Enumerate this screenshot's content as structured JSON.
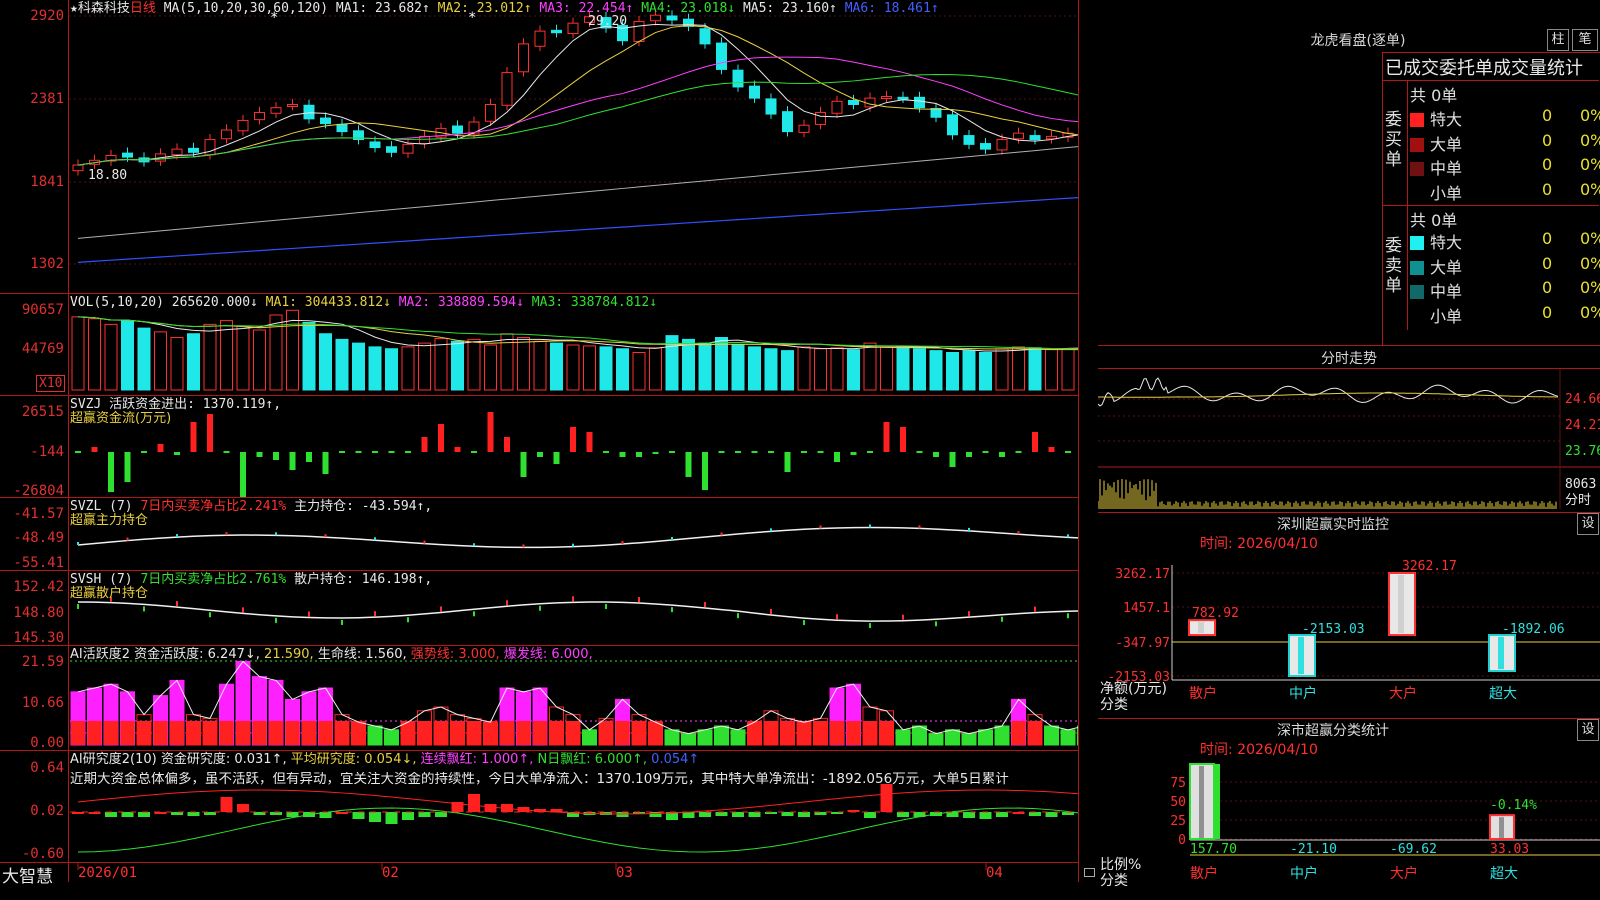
{
  "main": {
    "title_star": "★",
    "stock_name": "科森科技",
    "period": "日线",
    "ma_label": "MA(5,10,20,30,60,120)",
    "ma_values": [
      {
        "name": "MA1:",
        "value": "23.682↑",
        "color": "#e8e8e8"
      },
      {
        "name": "MA2:",
        "value": "23.012↑",
        "color": "#e8d040"
      },
      {
        "name": "MA3:",
        "value": "22.454↑",
        "color": "#ff40ff"
      },
      {
        "name": "MA4:",
        "value": "23.018↓",
        "color": "#30e030"
      },
      {
        "name": "MA5:",
        "value": "23.160↑",
        "color": "#c8c8c8"
      },
      {
        "name": "MA6:",
        "value": "18.461↑",
        "color": "#4060ff"
      }
    ],
    "y_labels": [
      "2920",
      "2381",
      "1841",
      "1302"
    ],
    "high_label": "29.20",
    "low_label": "18.80"
  },
  "vol": {
    "label": "VOL(5,10,20)",
    "value": "265620.000↓",
    "ma1": "MA1: 304433.812↓",
    "ma2": "MA2: 338889.594↓",
    "ma3": "MA3: 338784.812↓",
    "y_labels": [
      "90657",
      "44769"
    ],
    "unit": "X10"
  },
  "svzj": {
    "label": "SVZJ",
    "text": "活跃资金进出: 1370.119↑,",
    "sub": "超赢资金流(万元)",
    "y_labels": [
      "26515",
      "-144",
      "-26804"
    ]
  },
  "svzl": {
    "label": "SVZL (7)",
    "pct": "7日内买卖净占比2.241%",
    "text": "主力持仓: -43.594↑,",
    "sub": "超赢主力持仓",
    "y_labels": [
      "-41.57",
      "-48.49",
      "-55.41"
    ]
  },
  "svsh": {
    "label": "SVSH (7)",
    "pct": "7日内买卖净占比2.761%",
    "text": "散户持仓: 146.198↑,",
    "sub": "超赢散户持仓",
    "y_labels": [
      "152.42",
      "148.80",
      "145.30"
    ]
  },
  "ai1": {
    "label": "AI活跃度2",
    "t1": "资金活跃度: 6.247↓,",
    "t2": "21.590,",
    "t3": "生命线: 1.560,",
    "t4": "强势线: 3.000,",
    "t5": "爆发线: 6.000,",
    "y_labels": [
      "21.59",
      "10.66",
      "0.00"
    ]
  },
  "ai2": {
    "label": "AI研究度2(10)",
    "t1": "资金研究度: 0.031↑,",
    "t2": "平均研究度: 0.054↓,",
    "t3": "连续飘红: 1.000↑,",
    "t4": "N日飘红: 6.000↑,",
    "t5": "0.054↑",
    "comment": "近期大资金总体偏多，虽不活跃，但有异动，宜关注大资金的持续性，今日大单净流入：1370.109万元，其中特大单净流出：-1892.056万元，大单5日累计",
    "y_labels": [
      "0.64",
      "0.02",
      "-0.60"
    ]
  },
  "xaxis": {
    "brand": "大智慧",
    "labels": [
      "2026/01",
      "02",
      "03",
      "04"
    ]
  },
  "right": {
    "longhu_title": "龙虎看盘(逐单)",
    "btn1": "柱",
    "btn2": "笔",
    "tabs": "已成交委托单成交量统计",
    "buy": {
      "side": "委买单",
      "total": "共 0单",
      "rows": [
        {
          "label": "特大",
          "qty": "0",
          "pct": "0%",
          "color": "#ff2020"
        },
        {
          "label": "大单",
          "qty": "0",
          "pct": "0%",
          "color": "#a01010"
        },
        {
          "label": "中单",
          "qty": "0",
          "pct": "0%",
          "color": "#701010"
        },
        {
          "label": "小单",
          "qty": "0",
          "pct": "0%",
          "color": "#000000"
        }
      ]
    },
    "sell": {
      "side": "委卖单",
      "total": "共 0单",
      "rows": [
        {
          "label": "特大",
          "qty": "0",
          "pct": "0%",
          "color": "#20f0f0"
        },
        {
          "label": "大单",
          "qty": "0",
          "pct": "0%",
          "color": "#109090"
        },
        {
          "label": "中单",
          "qty": "0",
          "pct": "0%",
          "color": "#106868"
        },
        {
          "label": "小单",
          "qty": "0",
          "pct": "0%",
          "color": "#000000"
        }
      ]
    },
    "intraday": {
      "title": "分时走势",
      "y_labels": [
        "24.66",
        "24.21",
        "23.76"
      ],
      "vol_label": "8063",
      "vol_unit": "分时"
    },
    "sz_monitor": {
      "title": "深圳超赢实时监控",
      "set": "设",
      "time": "时间: 2026/04/10",
      "y_labels": [
        "3262.17",
        "1457.1",
        "-347.97",
        "-2153.03"
      ],
      "cats": [
        "散户",
        "中户",
        "大户",
        "超大"
      ],
      "values": [
        782.92,
        -2153.03,
        3262.17,
        -1892.06
      ],
      "value_labels": [
        "782.92",
        "-2153.03",
        "3262.17",
        "-1892.06"
      ],
      "ylabel": "净额(万元)",
      "xlabel": "分类"
    },
    "sz_class": {
      "title": "深市超赢分类统计",
      "set": "设",
      "time": "时间: 2026/04/10",
      "y_labels": [
        "75",
        "50",
        "25",
        "0"
      ],
      "cats": [
        "散户",
        "中户",
        "大户",
        "超大"
      ],
      "bar_values": [
        157.7,
        -21.1,
        -69.62,
        33.03
      ],
      "value_labels": [
        "157.70",
        "-21.10",
        "-69.62",
        "33.03"
      ],
      "pct_label": "-0.14%",
      "ylabel": "比例%",
      "xlabel": "分类"
    }
  },
  "chart_data": [
    {
      "type": "candlestick",
      "title": "科森科技 日线",
      "ylim": [
        13.02,
        29.2
      ],
      "series": [
        {
          "name": "K线",
          "close": [
            19.6,
            19.9,
            20.2,
            20.1,
            19.8,
            20.3,
            20.6,
            20.4,
            21.2,
            21.8,
            22.4,
            22.9,
            23.2,
            23.4,
            22.5,
            22.2,
            21.7,
            21.2,
            20.7,
            20.4,
            20.9,
            21.4,
            21.9,
            21.6,
            22.3,
            23.4,
            25.4,
            27.2,
            28.0,
            27.9,
            28.5,
            28.9,
            28.2,
            27.4,
            28.6,
            29.0,
            28.7,
            28.3,
            27.2,
            25.6,
            24.5,
            23.8,
            22.8,
            21.7,
            22.1,
            22.9,
            23.6,
            23.4,
            23.8,
            23.9,
            23.8,
            23.2,
            22.6,
            21.5,
            20.9,
            20.6,
            21.2,
            21.6,
            21.2,
            21.4,
            21.6,
            21.9,
            22.1,
            22.5,
            22.8,
            23.1,
            23.5,
            23.8
          ]
        }
      ]
    },
    {
      "type": "bar",
      "title": "VOL(5,10,20)",
      "values_label": "X10",
      "ylim": [
        0,
        90657
      ],
      "series": [
        {
          "name": "VOL",
          "values": [
            78000,
            76000,
            70000,
            74000,
            66000,
            62000,
            56000,
            60000,
            70000,
            74000,
            68000,
            64000,
            80000,
            85000,
            72000,
            60000,
            54000,
            50000,
            46000,
            44000,
            46000,
            50000,
            55000,
            52000,
            54000,
            48000,
            60000,
            56000,
            52000,
            50000,
            48000,
            47000,
            46000,
            44000,
            40000,
            45000,
            58000,
            54000,
            50000,
            56000,
            48000,
            46000,
            44000,
            42000,
            46000,
            44000,
            45000,
            43000,
            50000,
            46000,
            46000,
            44000,
            42000,
            40000,
            42000,
            40000,
            44000,
            46000,
            45000,
            43000,
            44000,
            46000,
            48000,
            45000,
            44000,
            45000,
            43000,
            42000
          ]
        }
      ]
    }
  ]
}
